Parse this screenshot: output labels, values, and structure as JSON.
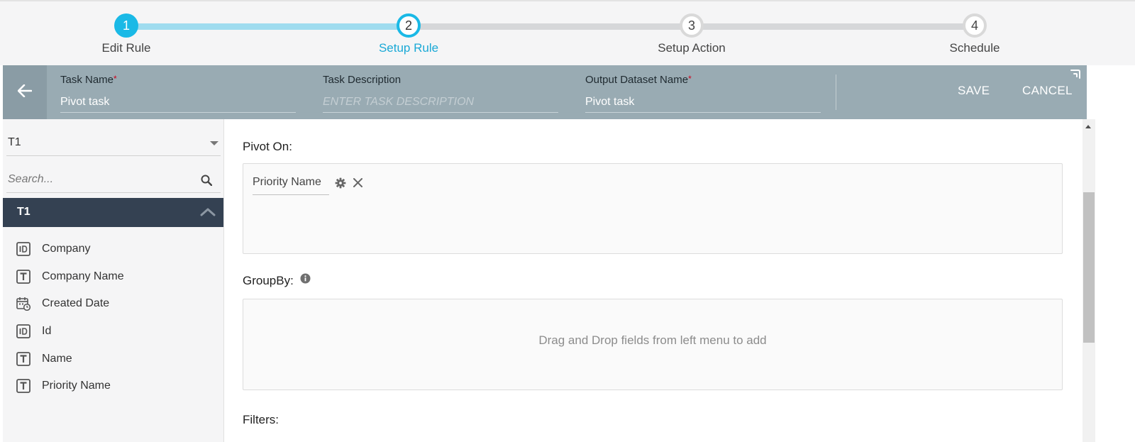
{
  "stepper": {
    "steps": [
      {
        "number": "1",
        "label": "Edit Rule",
        "state": "done"
      },
      {
        "number": "2",
        "label": "Setup Rule",
        "state": "active"
      },
      {
        "number": "3",
        "label": "Setup Action",
        "state": "todo"
      },
      {
        "number": "4",
        "label": "Schedule",
        "state": "todo"
      }
    ]
  },
  "header": {
    "task_name_label": "Task Name",
    "task_name_value": "Pivot task",
    "task_description_label": "Task Description",
    "task_description_placeholder": "ENTER TASK DESCRIPTION",
    "output_dataset_label": "Output Dataset Name",
    "output_dataset_value": "Pivot task",
    "required_marker": "*",
    "save_label": "SAVE",
    "cancel_label": "CANCEL",
    "back_icon": "arrow-left-icon"
  },
  "left_panel": {
    "dataset_selected": "T1",
    "search_placeholder": "Search...",
    "table_name": "T1",
    "fields": [
      {
        "label": "Company",
        "type": "id"
      },
      {
        "label": "Company Name",
        "type": "text"
      },
      {
        "label": "Created Date",
        "type": "date"
      },
      {
        "label": "Id",
        "type": "id"
      },
      {
        "label": "Name",
        "type": "text"
      },
      {
        "label": "Priority Name",
        "type": "text"
      }
    ]
  },
  "main": {
    "pivot_on_title": "Pivot On:",
    "pivot_on_field": "Priority Name",
    "groupby_title": "GroupBy:",
    "groupby_hint": "Drag and Drop fields from left menu to add",
    "filters_title": "Filters:"
  },
  "colors": {
    "accent": "#1ab9e6",
    "header_bg": "#99abb3",
    "table_header_bg": "#344152",
    "required": "#d0021b"
  }
}
